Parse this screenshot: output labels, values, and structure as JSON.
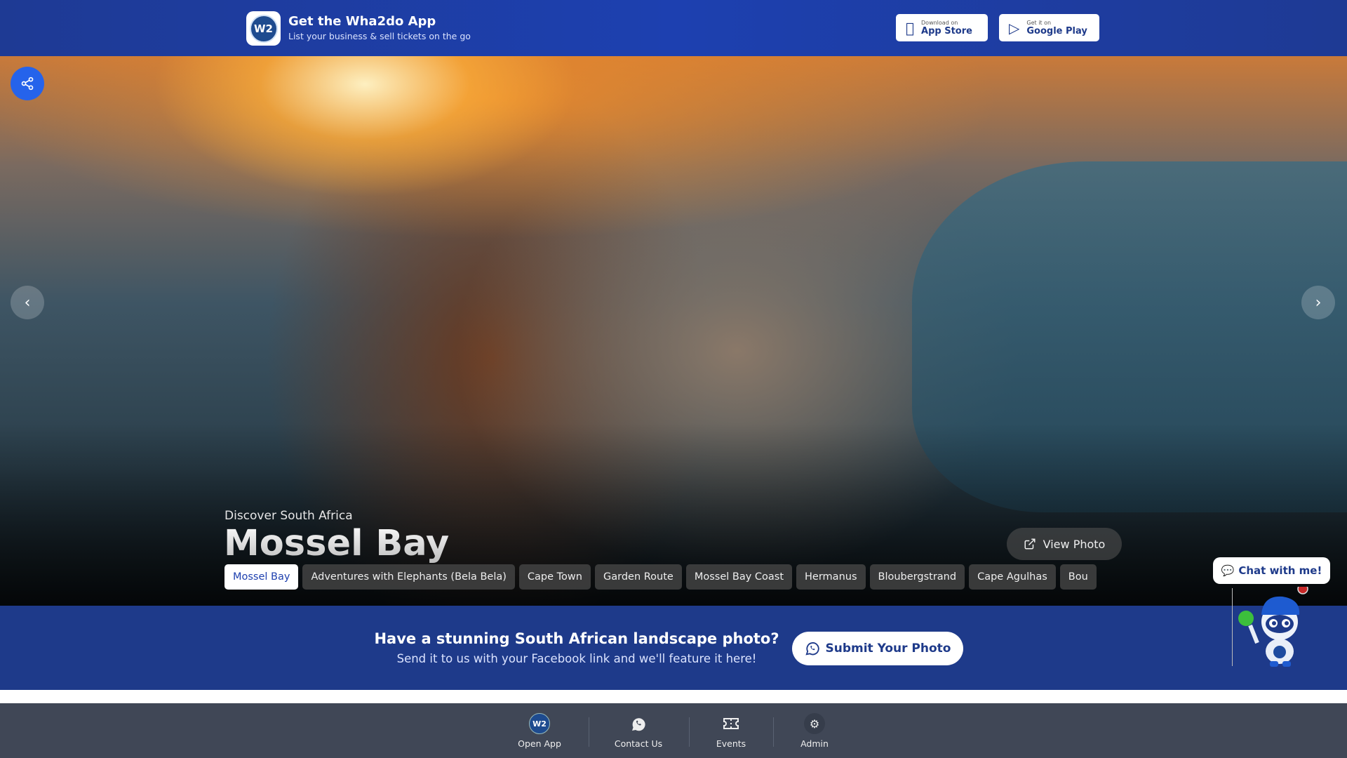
{
  "header": {
    "title": "Get the Wha2do App",
    "subtitle": "List your business & sell tickets on the go",
    "logo_text": "W2",
    "app_store": {
      "small": "Download on",
      "label": "App Store"
    },
    "google_play": {
      "small": "Get it on",
      "label": "Google Play"
    }
  },
  "hero": {
    "kicker": "Discover South Africa",
    "title": "Mossel Bay",
    "view_photo": "View Photo",
    "chips": [
      "Mossel Bay",
      "Adventures with Elephants (Bela Bela)",
      "Cape Town",
      "Garden Route",
      "Mossel Bay Coast",
      "Hermanus",
      "Bloubergstrand",
      "Cape Agulhas",
      "Bou"
    ]
  },
  "band": {
    "heading": "Have a stunning South African landscape photo?",
    "subtext": "Send it to us with your Facebook link and we'll feature it here!",
    "submit": "Submit Your Photo"
  },
  "chat": {
    "label": "Chat with me!"
  },
  "footer": {
    "items": [
      "Open App",
      "Contact Us",
      "Events",
      "Admin"
    ]
  },
  "colors": {
    "header": "#1d40b0",
    "band": "#1e3a8a",
    "footer": "#404756",
    "accent": "#2563eb"
  }
}
